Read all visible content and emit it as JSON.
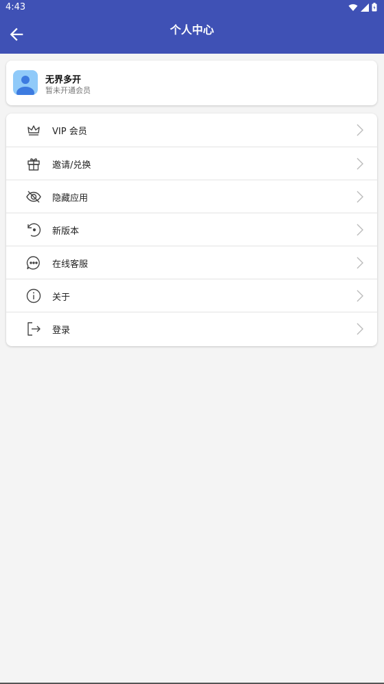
{
  "status_bar": {
    "time": "4:43",
    "icons": [
      "wifi-icon",
      "signal-icon",
      "battery-icon"
    ]
  },
  "app_bar": {
    "title": "个人中心",
    "back_icon": "arrow-back-icon"
  },
  "profile": {
    "name": "无界多开",
    "subtitle": "暂未开通会员",
    "avatar_icon": "user-avatar-icon"
  },
  "menu": {
    "items": [
      {
        "label": "VIP 会员",
        "icon": "crown-icon"
      },
      {
        "label": "邀请/兑换",
        "icon": "gift-icon"
      },
      {
        "label": "隐藏应用",
        "icon": "eye-off-icon"
      },
      {
        "label": "新版本",
        "icon": "update-icon"
      },
      {
        "label": "在线客服",
        "icon": "chat-icon"
      },
      {
        "label": "关于",
        "icon": "info-icon"
      },
      {
        "label": "登录",
        "icon": "login-icon"
      }
    ]
  },
  "colors": {
    "primary": "#3f51b5",
    "background": "#f4f4f4",
    "card": "#ffffff",
    "avatar": "#90caf9"
  }
}
